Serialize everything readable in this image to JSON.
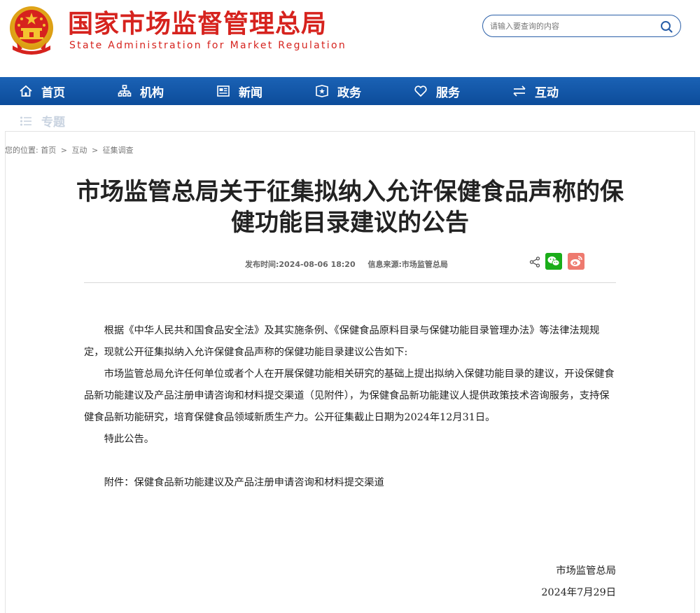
{
  "header": {
    "title_cn": "国家市场监督管理总局",
    "title_en": "State Administration for Market Regulation",
    "search_placeholder": "请输入要查询的内容"
  },
  "nav": {
    "items": [
      {
        "label": "首页",
        "icon": "home-icon"
      },
      {
        "label": "机构",
        "icon": "org-chart-icon"
      },
      {
        "label": "新闻",
        "icon": "news-icon"
      },
      {
        "label": "政务",
        "icon": "government-icon"
      },
      {
        "label": "服务",
        "icon": "heart-icon"
      },
      {
        "label": "互动",
        "icon": "swap-arrows-icon"
      }
    ],
    "sub_items": [
      {
        "label": "专题",
        "icon": "list-icon"
      }
    ]
  },
  "breadcrumb": {
    "prefix": "您的位置:",
    "items": [
      "首页",
      "互动",
      "征集调查"
    ],
    "separator": ">"
  },
  "article": {
    "title": "市场监管总局关于征集拟纳入允许保健食品声称的保健功能目录建议的公告",
    "publish_label": "发布时间:",
    "publish_time": "2024-08-06 18:20",
    "source_label": "信息来源:",
    "source": "市场监管总局",
    "paragraphs": [
      "根据《中华人民共和国食品安全法》及其实施条例、《保健食品原料目录与保健功能目录管理办法》等法律法规规定，现就公开征集拟纳入允许保健食品声称的保健功能目录建议公告如下:",
      "市场监管总局允许任何单位或者个人在开展保健功能相关研究的基础上提出拟纳入保健功能目录的建议，开设保健食品新功能建议及产品注册申请咨询和材料提交渠道（见附件），为保健食品新功能建议人提供政策技术咨询服务，支持保健食品新功能研究，培育保健食品领域新质生产力。公开征集截止日期为2024年12月31日。",
      "特此公告。"
    ],
    "attachment": "附件：保健食品新功能建议及产品注册申请咨询和材料提交渠道",
    "signoff_org": "市场监管总局",
    "signoff_date": "2024年7月29日"
  },
  "colors": {
    "brand_red": "#d6231e",
    "nav_blue": "#1b62b5",
    "wechat_green": "#1aad19",
    "weibo_red": "#ee7a6f"
  }
}
